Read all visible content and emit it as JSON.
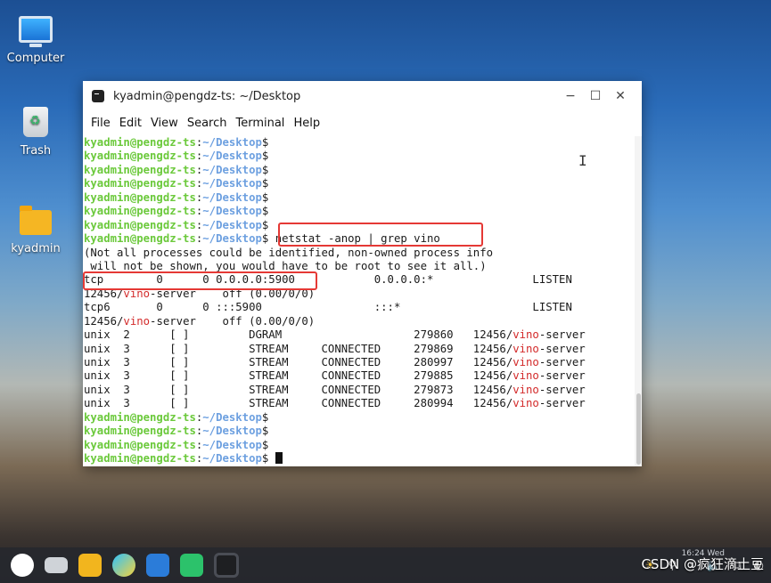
{
  "desktop": {
    "icons": [
      {
        "label": "Computer"
      },
      {
        "label": "Trash"
      },
      {
        "label": "kyadmin"
      }
    ]
  },
  "window": {
    "title": "kyadmin@pengdz-ts: ~/Desktop",
    "controls": {
      "minimize": "−",
      "maximize": "☐",
      "close": "✕"
    },
    "menu": [
      "File",
      "Edit",
      "View",
      "Search",
      "Terminal",
      "Help"
    ]
  },
  "terminal": {
    "prompt_user": "kyadmin@pengdz-ts",
    "prompt_sep": ":",
    "prompt_path": "~/Desktop",
    "prompt_end": "$",
    "command": " netstat -anop | grep vino",
    "msg1": "(Not all processes could be identified, non-owned process info",
    "msg2": " will not be shown, you would have to be root to see it all.)",
    "tcp_line": "tcp        0      0 0.0.0.0:5900            0.0.0.0:*               LISTEN",
    "tcp_pid": "12456/",
    "vino": "vino",
    "tcp_rest": "-server    off (0.00/0/0)",
    "tcp6_line": "tcp6       0      0 :::5900                 :::*                    LISTEN",
    "unix_rows": [
      {
        "pre": "unix  2      [ ]         DGRAM                    279860   12456/",
        "post": "-server"
      },
      {
        "pre": "unix  3      [ ]         STREAM     CONNECTED     279869   12456/",
        "post": "-server"
      },
      {
        "pre": "unix  3      [ ]         STREAM     CONNECTED     280997   12456/",
        "post": "-server"
      },
      {
        "pre": "unix  3      [ ]         STREAM     CONNECTED     279885   12456/",
        "post": "-server"
      },
      {
        "pre": "unix  3      [ ]         STREAM     CONNECTED     279873   12456/",
        "post": "-server"
      },
      {
        "pre": "unix  3      [ ]         STREAM     CONNECTED     280994   12456/",
        "post": "-server"
      }
    ]
  },
  "taskbar": {
    "clock": "16:24 Wed",
    "tray_icons": [
      "brightness-icon",
      "search-icon",
      "chevron-right-icon",
      "volume-icon",
      "network-icon",
      "power-icon"
    ]
  },
  "watermark": "CSDN @疯狂滴土豆",
  "colors": {
    "accent_red": "#e53935",
    "prompt_green": "#6bc93b",
    "prompt_blue": "#6da0e0"
  }
}
